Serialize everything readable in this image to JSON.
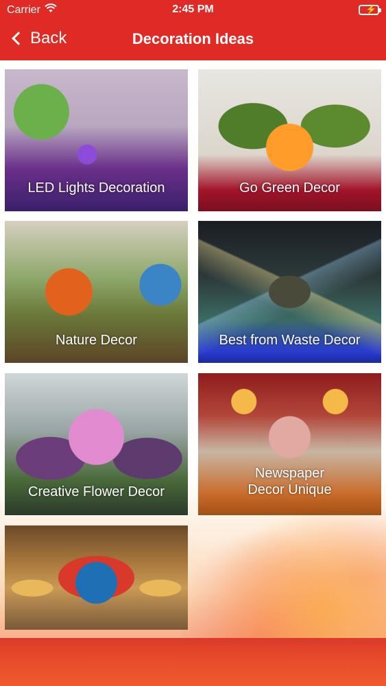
{
  "status_bar": {
    "carrier": "Carrier",
    "time": "2:45 PM"
  },
  "nav": {
    "back_label": "Back",
    "title": "Decoration Ideas"
  },
  "items": [
    {
      "caption": "LED Lights Decoration"
    },
    {
      "caption": "Go Green Decor"
    },
    {
      "caption": "Nature Decor"
    },
    {
      "caption": "Best from Waste Decor"
    },
    {
      "caption": "Creative Flower Decor"
    },
    {
      "caption": "Newspaper\nDecor Unique"
    },
    {
      "caption": ""
    }
  ],
  "colors": {
    "header": "#e02a25",
    "footer": "#e64a2b"
  }
}
